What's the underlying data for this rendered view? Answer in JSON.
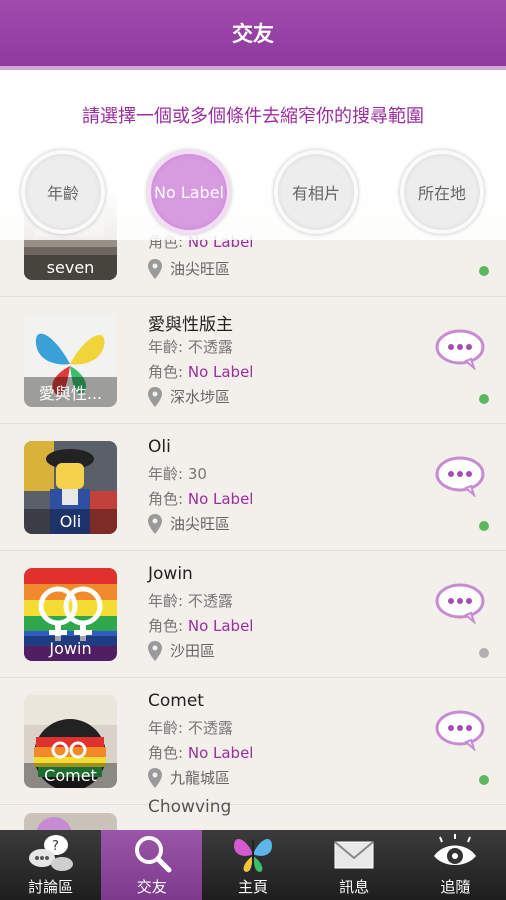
{
  "header": {
    "title": "交友"
  },
  "filter": {
    "hint": "請選擇一個或多個條件去縮窄你的搜尋範圍",
    "chips": [
      {
        "label": "年齡",
        "active": false
      },
      {
        "label": "No Label",
        "active": true
      },
      {
        "label": "有相片",
        "active": false
      },
      {
        "label": "所在地",
        "active": false
      }
    ]
  },
  "list": {
    "age_prefix": "年齡:",
    "role_prefix": "角色:",
    "partial_top": {
      "avatar_name": "seven",
      "role": "No Label",
      "location": "油尖旺區",
      "status": "online"
    },
    "users": [
      {
        "name": "愛與性版主",
        "avatar_name": "愛與性...",
        "age": "不透露",
        "role": "No Label",
        "location": "深水埗區",
        "status": "online"
      },
      {
        "name": "Oli",
        "avatar_name": "Oli",
        "age": "30",
        "role": "No Label",
        "location": "油尖旺區",
        "status": "online"
      },
      {
        "name": "Jowin",
        "avatar_name": "Jowin",
        "age": "不透露",
        "role": "No Label",
        "location": "沙田區",
        "status": "offline"
      },
      {
        "name": "Comet",
        "avatar_name": "Comet",
        "age": "不透露",
        "role": "No Label",
        "location": "九龍城區",
        "status": "online"
      }
    ],
    "partial_bottom": {
      "name": "Chowving"
    }
  },
  "colors": {
    "brand": "#9b3fa8",
    "online": "#5cb85c",
    "offline": "#b0b0b0",
    "role": "#9b2d9e"
  },
  "tabs": [
    {
      "label": "討論區",
      "icon": "discussion-icon",
      "active": false
    },
    {
      "label": "交友",
      "icon": "search-icon",
      "active": true
    },
    {
      "label": "主頁",
      "icon": "butterfly-icon",
      "active": false
    },
    {
      "label": "訊息",
      "icon": "mail-icon",
      "active": false
    },
    {
      "label": "追隨",
      "icon": "eye-icon",
      "active": false
    }
  ]
}
